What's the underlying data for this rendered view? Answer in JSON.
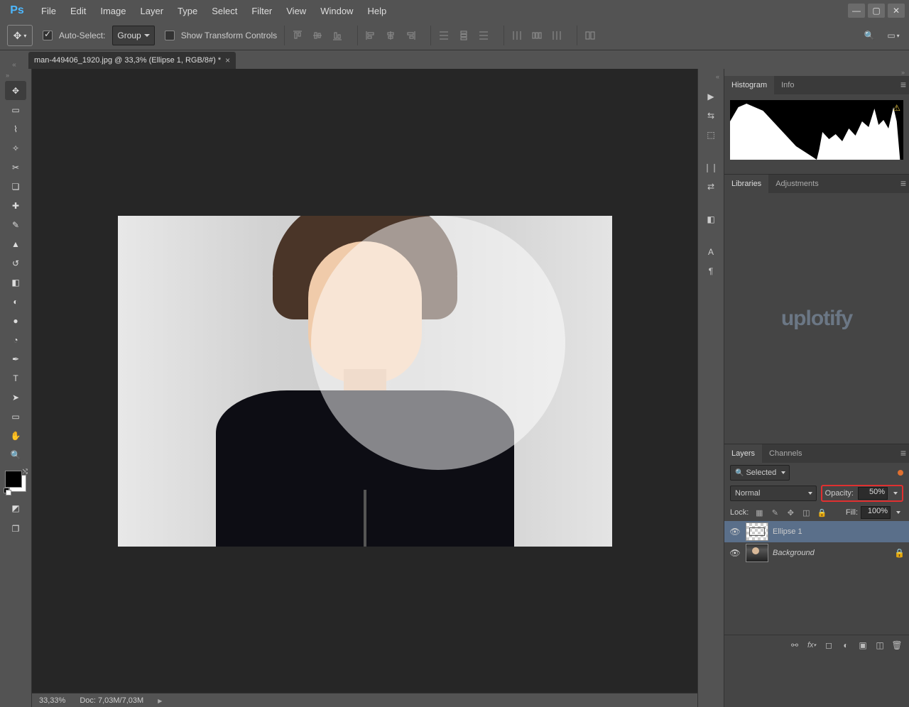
{
  "app_logo_text": "Ps",
  "menubar": [
    "File",
    "Edit",
    "Image",
    "Layer",
    "Type",
    "Select",
    "Filter",
    "View",
    "Window",
    "Help"
  ],
  "optbar": {
    "auto_select_checked": true,
    "auto_select_label": "Auto-Select:",
    "auto_select_mode": "Group",
    "show_tc_checked": false,
    "show_tc_label": "Show Transform Controls"
  },
  "doc_tab": {
    "title": "man-449406_1920.jpg @ 33,3% (Ellipse 1, RGB/8#) *",
    "close_glyph": "×"
  },
  "tools": [
    {
      "id": "move",
      "glyph": "✥",
      "active": true
    },
    {
      "id": "marquee",
      "glyph": "▭"
    },
    {
      "id": "lasso",
      "glyph": "⌇"
    },
    {
      "id": "wand",
      "glyph": "✧"
    },
    {
      "id": "crop",
      "glyph": "✂"
    },
    {
      "id": "eyedropper",
      "glyph": "❏"
    },
    {
      "id": "healing",
      "glyph": "✚"
    },
    {
      "id": "brush",
      "glyph": "✎"
    },
    {
      "id": "stamp",
      "glyph": "▲"
    },
    {
      "id": "history-brush",
      "glyph": "↺"
    },
    {
      "id": "eraser",
      "glyph": "◧"
    },
    {
      "id": "gradient",
      "glyph": "◐"
    },
    {
      "id": "blur",
      "glyph": "●"
    },
    {
      "id": "dodge",
      "glyph": "◔"
    },
    {
      "id": "pen",
      "glyph": "✒"
    },
    {
      "id": "type",
      "glyph": "T"
    },
    {
      "id": "path-select",
      "glyph": "➤"
    },
    {
      "id": "shape",
      "glyph": "▭"
    },
    {
      "id": "hand",
      "glyph": "✋"
    },
    {
      "id": "zoom",
      "glyph": "🔍"
    }
  ],
  "extra_tools": [
    {
      "id": "quickmask",
      "glyph": "◩"
    },
    {
      "id": "screenmode",
      "glyph": "❐"
    }
  ],
  "dock_icons": [
    {
      "id": "play",
      "glyph": "▶"
    },
    {
      "id": "actions",
      "glyph": "⇆"
    },
    {
      "id": "3d",
      "glyph": "⬚"
    },
    {
      "sep": true
    },
    {
      "id": "brushes",
      "glyph": "❘❘"
    },
    {
      "id": "brush-settings",
      "glyph": "⇄"
    },
    {
      "sep": true
    },
    {
      "id": "swatches",
      "glyph": "◧"
    },
    {
      "sep": true
    },
    {
      "id": "character",
      "glyph": "A"
    },
    {
      "id": "paragraph",
      "glyph": "¶"
    }
  ],
  "panels": {
    "hist": {
      "tabs": [
        "Histogram",
        "Info"
      ],
      "active": 0,
      "warning_glyph": "⚠"
    },
    "lib": {
      "tabs": [
        "Libraries",
        "Adjustments"
      ],
      "active": 0,
      "watermark": "uplotify"
    },
    "layers": {
      "tabs": [
        "Layers",
        "Channels"
      ],
      "active": 0,
      "filter_label": "Selected",
      "filter_icon": "🔍",
      "blend_mode": "Normal",
      "opacity_label": "Opacity:",
      "opacity_value": "50%",
      "lock_label": "Lock:",
      "fill_label": "Fill:",
      "fill_value": "100%",
      "items": [
        {
          "name": "Ellipse 1",
          "selected": true,
          "thumb": "shape",
          "locked": false,
          "italic": false
        },
        {
          "name": "Background",
          "selected": false,
          "thumb": "bg",
          "locked": true,
          "italic": true
        }
      ],
      "footer_icons": [
        "link",
        "fx",
        "mask",
        "adjust",
        "group",
        "new",
        "trash"
      ]
    }
  },
  "status": {
    "zoom": "33,33%",
    "doc": "Doc: 7,03M/7,03M"
  },
  "search_glyph": "🔍",
  "layout_glyph": "▭"
}
